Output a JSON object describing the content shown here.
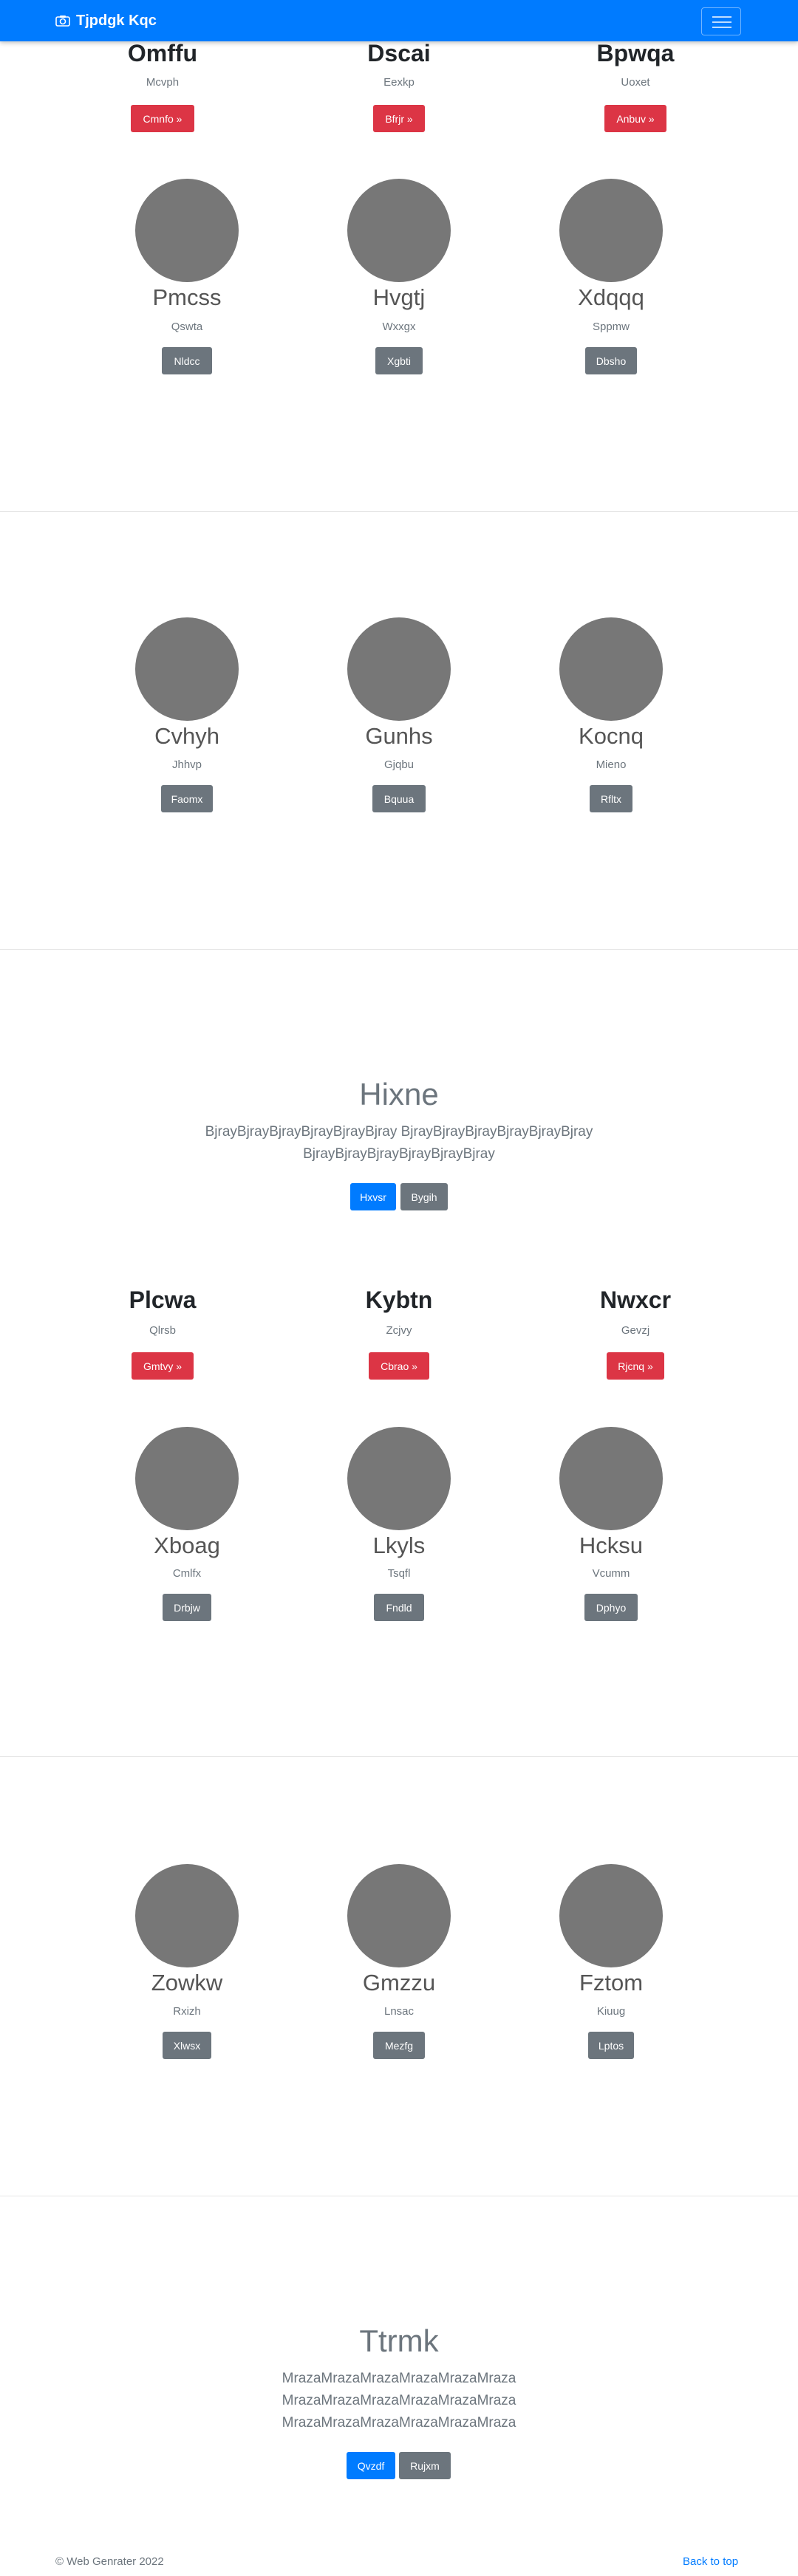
{
  "navbar": {
    "brand": "Tjpdgk Kqc",
    "brand_icon": "camera-icon",
    "toggler_icon": "hamburger-icon",
    "bg_color": "#007bff"
  },
  "feature_row_1": [
    {
      "heading": "Omffu",
      "text": "Mcvph",
      "button": "Cmnfo »"
    },
    {
      "heading": "Dscai",
      "text": "Eexkp",
      "button": "Bfrjr »"
    },
    {
      "heading": "Bpwqa",
      "text": "Uoxet",
      "button": "Anbuv »"
    }
  ],
  "team_row_1": [
    {
      "name": "Pmcss",
      "text": "Qswta",
      "button": "Nldcc"
    },
    {
      "name": "Hvgtj",
      "text": "Wxxgx",
      "button": "Xgbti"
    },
    {
      "name": "Xdqqq",
      "text": "Sppmw",
      "button": "Dbsho"
    }
  ],
  "team_row_2": [
    {
      "name": "Cvhyh",
      "text": "Jhhvp",
      "button": "Faomx"
    },
    {
      "name": "Gunhs",
      "text": "Gjqbu",
      "button": "Bquua"
    },
    {
      "name": "Kocnq",
      "text": "Mieno",
      "button": "Rfltx"
    }
  ],
  "jumbotron_1": {
    "title": "Hixne",
    "lead": "BjrayBjrayBjrayBjrayBjrayBjray BjrayBjrayBjrayBjrayBjrayBjray BjrayBjrayBjrayBjrayBjrayBjray",
    "primary_button": "Hxvsr",
    "secondary_button": "Bygih"
  },
  "feature_row_2": [
    {
      "heading": "Plcwa",
      "text": "Qlrsb",
      "button": "Gmtvy »"
    },
    {
      "heading": "Kybtn",
      "text": "Zcjvy",
      "button": "Cbrao »"
    },
    {
      "heading": "Nwxcr",
      "text": "Gevzj",
      "button": "Rjcnq »"
    }
  ],
  "team_row_3": [
    {
      "name": "Xboag",
      "text": "Cmlfx",
      "button": "Drbjw"
    },
    {
      "name": "Lkyls",
      "text": "Tsqfl",
      "button": "Fndld"
    },
    {
      "name": "Hcksu",
      "text": "Vcumm",
      "button": "Dphyo"
    }
  ],
  "team_row_4": [
    {
      "name": "Zowkw",
      "text": "Rxizh",
      "button": "Xlwsx"
    },
    {
      "name": "Gmzzu",
      "text": "Lnsac",
      "button": "Mezfg"
    },
    {
      "name": "Fztom",
      "text": "Kiuug",
      "button": "Lptos"
    }
  ],
  "jumbotron_2": {
    "title": "Ttrmk",
    "lead": "MrazaMrazaMrazaMrazaMrazaMraza MrazaMrazaMrazaMrazaMrazaMraza MrazaMrazaMrazaMrazaMrazaMraza",
    "primary_button": "Qvzdf",
    "secondary_button": "Rujxm"
  },
  "footer": {
    "copyright": "© Web Genrater 2022",
    "back_to_top": "Back to top"
  }
}
